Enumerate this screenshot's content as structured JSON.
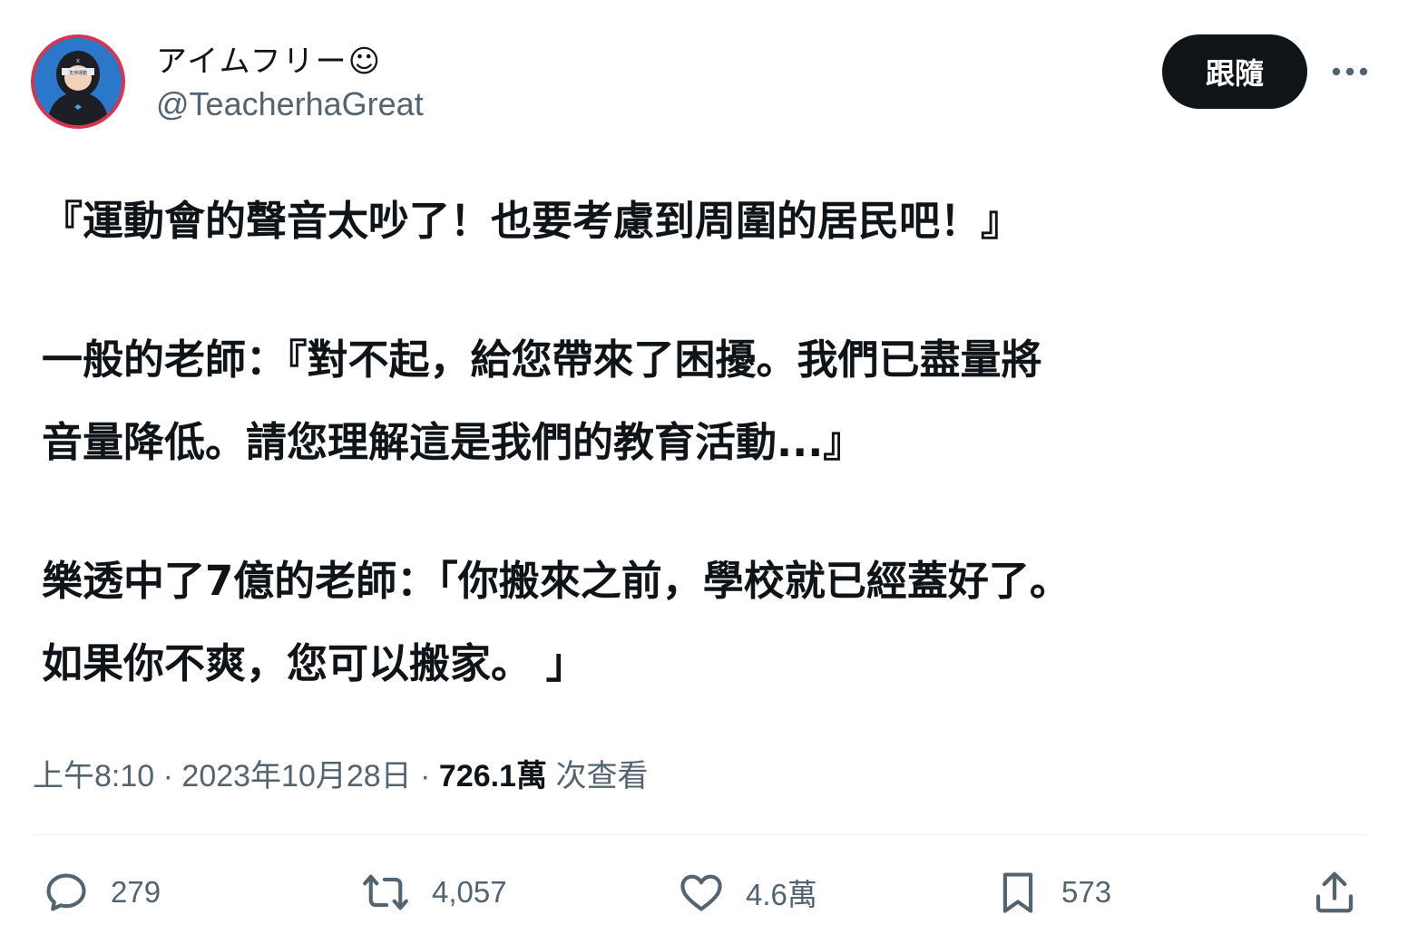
{
  "author": {
    "display_name": "アイムフリー☺",
    "handle": "@TeacherhaGreat",
    "avatar_badge_mark": "x",
    "avatar_badge_text": "支持運動"
  },
  "follow_label": "跟隨",
  "more_icon": "more-horizontal-icon",
  "tweet": {
    "paragraphs": [
      [
        "『運動會的聲音太吵了！也要考慮到周圍的居民吧！』"
      ],
      [
        "一般的老師：『對不起，給您帶來了困擾。我們已盡量將",
        "音量降低。請您理解這是我們的教育活動...』"
      ],
      [
        "樂透中了7億的老師：「你搬來之前，學校就已經蓋好了。",
        "如果你不爽，您可以搬家。 」"
      ]
    ]
  },
  "meta": {
    "time": "上午8:10",
    "separator": " · ",
    "date": "2023年10月28日",
    "views_count": "726.1萬",
    "views_label": " 次查看"
  },
  "actions": {
    "reply": {
      "icon": "reply-icon",
      "count": "279"
    },
    "retweet": {
      "icon": "retweet-icon",
      "count": "4,057"
    },
    "like": {
      "icon": "heart-icon",
      "count": "4.6萬"
    },
    "bookmark": {
      "icon": "bookmark-icon",
      "count": "573"
    },
    "share": {
      "icon": "share-icon"
    }
  },
  "colors": {
    "text_primary": "#0f1419",
    "text_secondary": "#536471",
    "follow_bg": "#0f1419",
    "avatar_ring": "#d8344f",
    "avatar_bg": "#2b77c9",
    "divider": "#eff3f4"
  }
}
